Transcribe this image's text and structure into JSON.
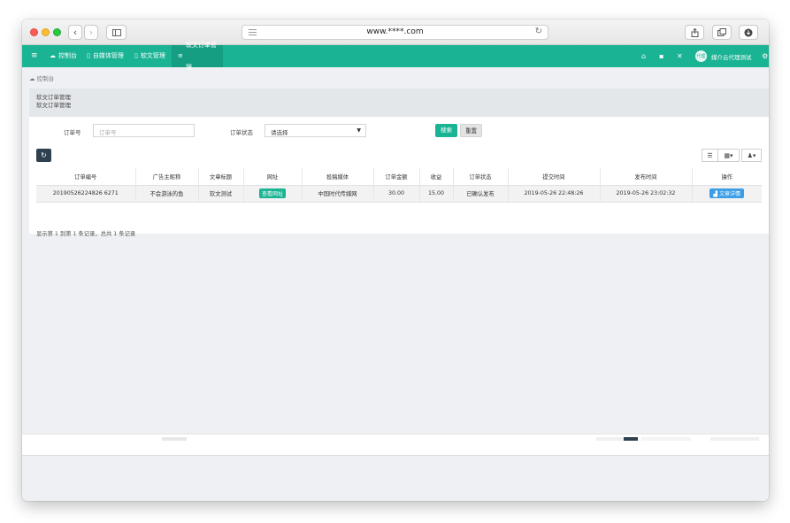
{
  "browser": {
    "url": "www.****.com"
  },
  "navbar": {
    "items": [
      {
        "icon": "dashboard-icon",
        "label": "控制台"
      },
      {
        "icon": "file-icon",
        "label": "自媒体管理"
      },
      {
        "icon": "file-icon",
        "label": "软文管理"
      },
      {
        "icon": "list-icon",
        "label": "软文订单管理"
      }
    ],
    "user_avatar_text": "代理",
    "user_name": "媒介云代理测试"
  },
  "breadcrumb": {
    "label": "控制台"
  },
  "page_head": {
    "title": "软文订单管理",
    "subtitle": "软文订单管理"
  },
  "filters": {
    "order_no_label": "订单号",
    "order_no_placeholder": "订单号",
    "status_label": "订单状态",
    "status_value": "请选择",
    "search_label": "搜索",
    "reset_label": "重置"
  },
  "table": {
    "columns": [
      "订单编号",
      "广告主昵称",
      "文章标题",
      "网址",
      "投稿媒体",
      "订单金额",
      "收益",
      "订单状态",
      "提交时间",
      "发布时间",
      "操作"
    ],
    "rows": [
      {
        "order_no": "20190526224826 6271",
        "advertiser": "不会游泳的鱼",
        "title": "软文测试",
        "url_button": "查看网址",
        "media": "中国时代传媒网",
        "amount": "30.00",
        "profit": "15.00",
        "status": "已确认发布",
        "submit_time": "2019-05-26 22:48:26",
        "publish_time": "2019-05-26 23:02:32",
        "action": "文章详情"
      }
    ]
  },
  "summary": "显示第 1 到第 1 条记录，总共 1 条记录",
  "colors": {
    "primary": "#1ab394",
    "dark": "#2f4050",
    "info": "#3a9de6"
  }
}
